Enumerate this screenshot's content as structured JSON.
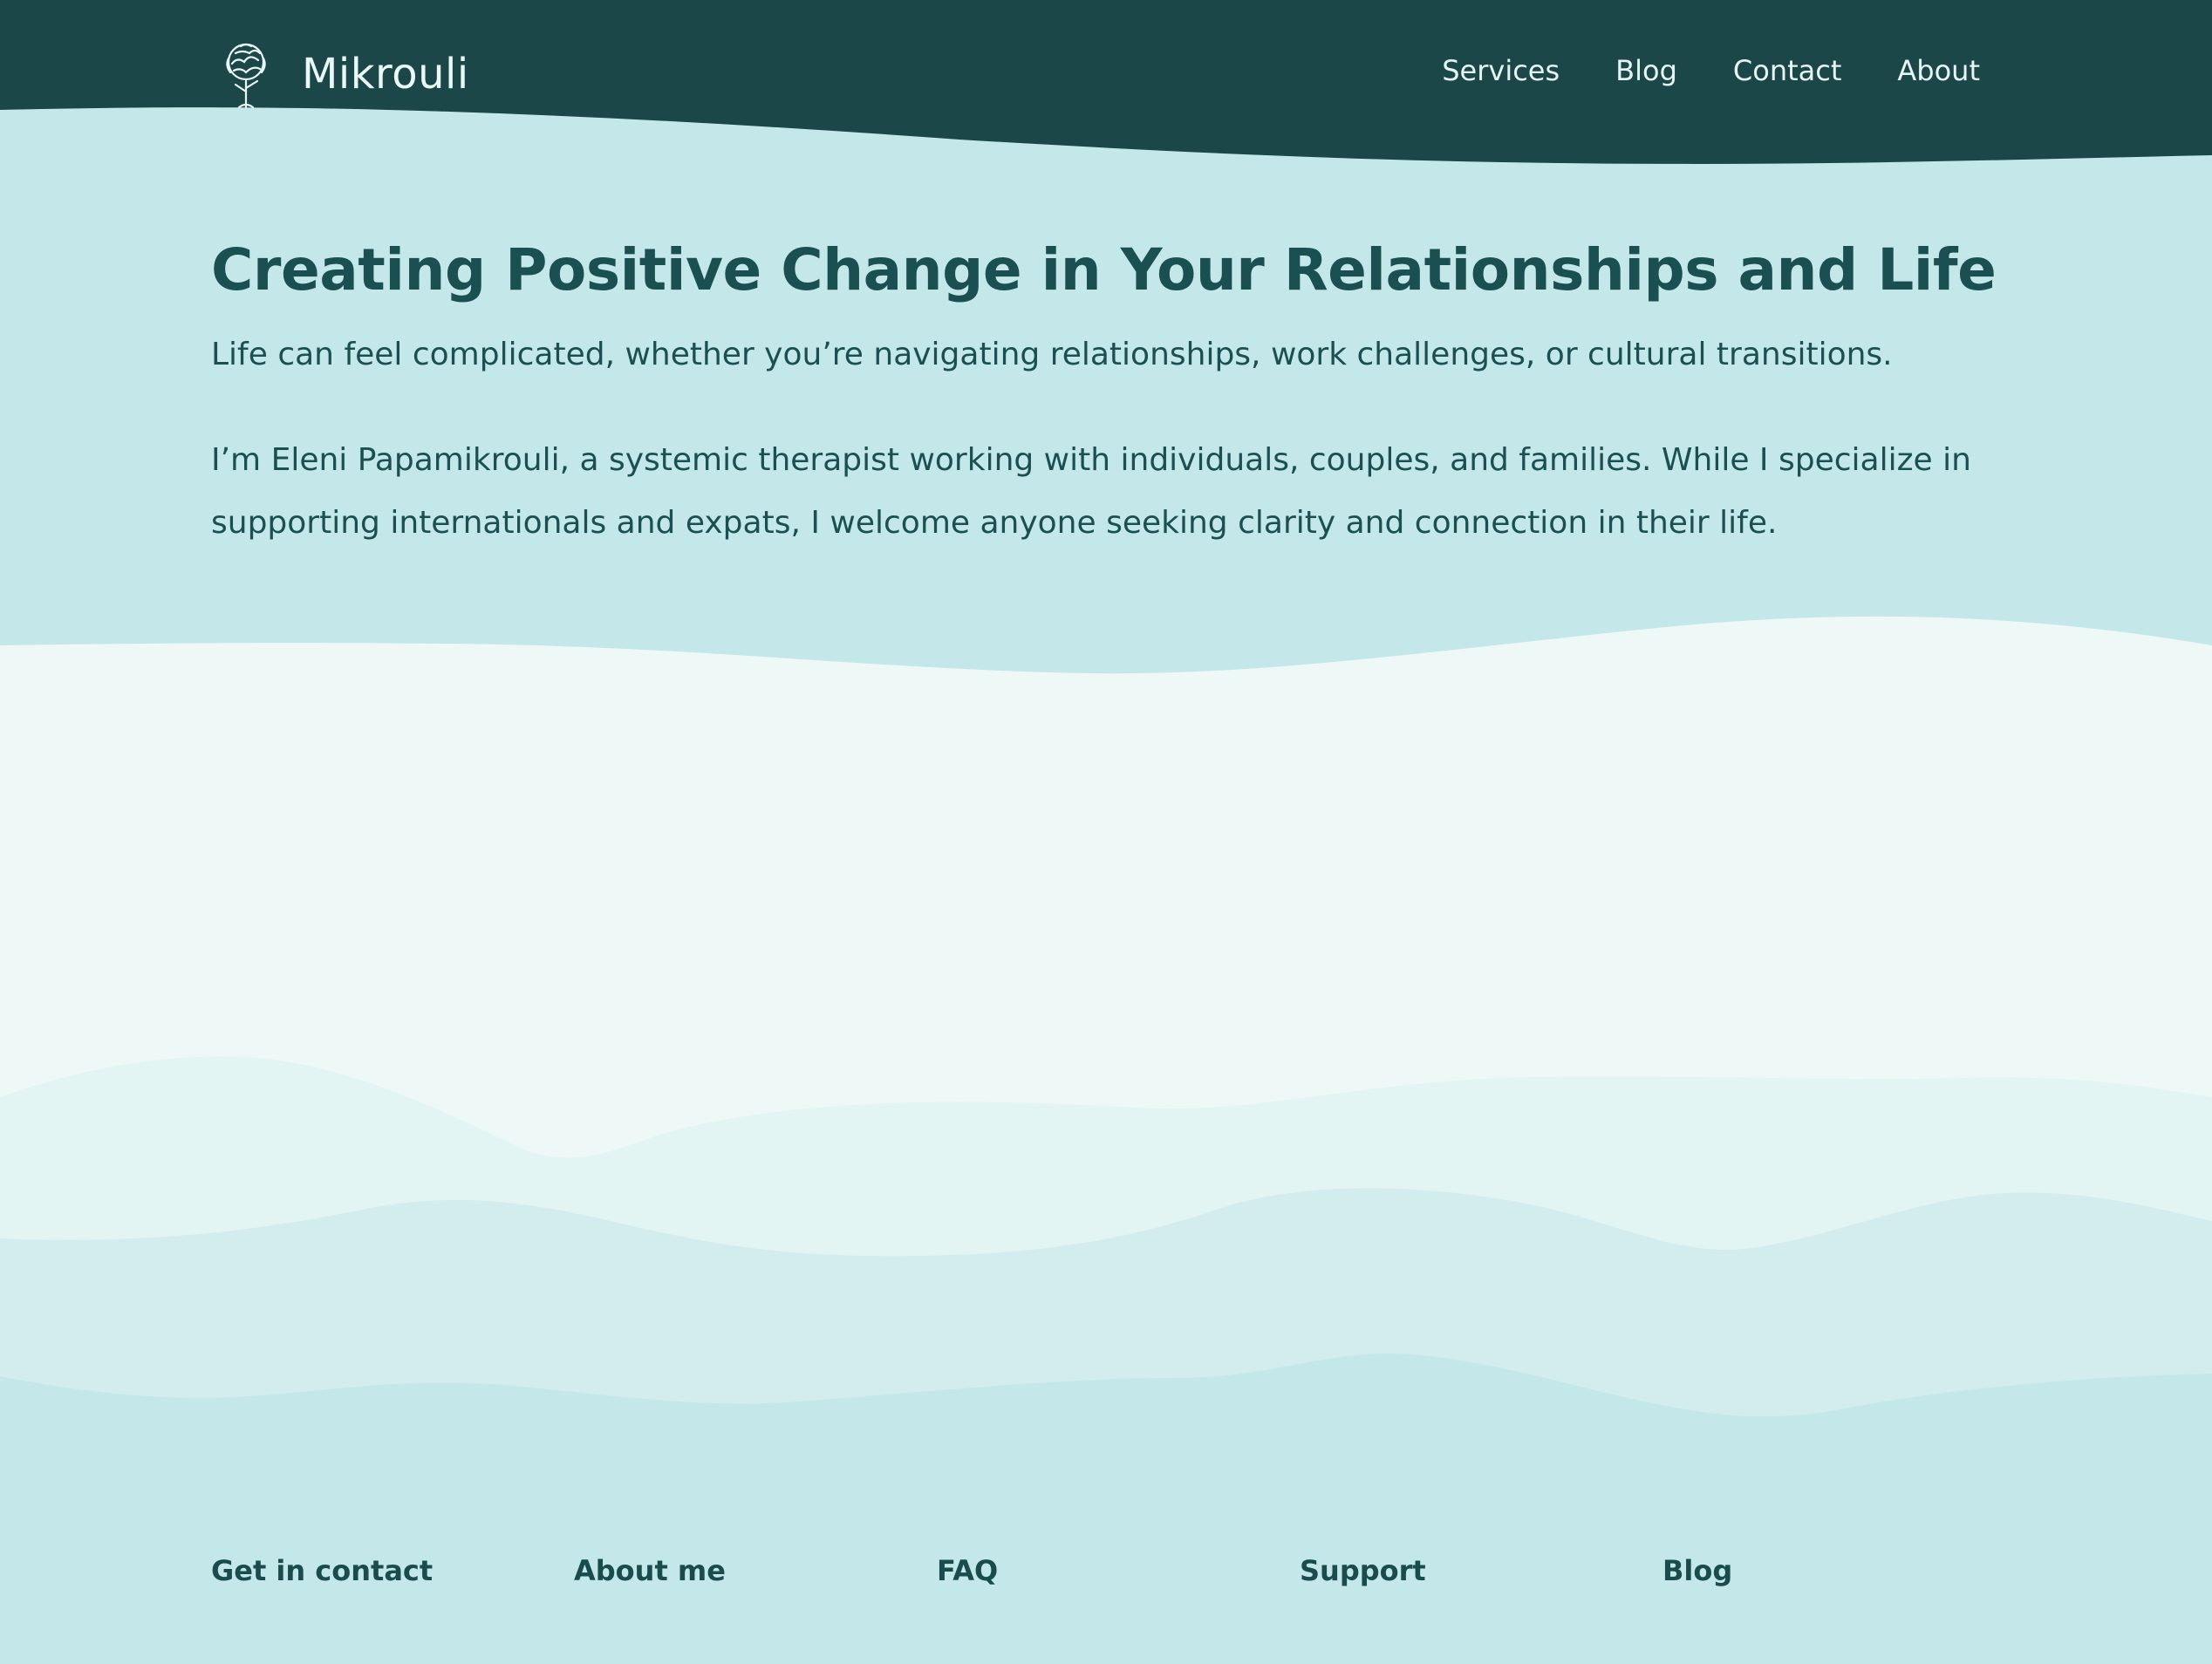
{
  "brand": {
    "name": "Mikrouli",
    "icon": "tree-icon"
  },
  "nav": {
    "items": [
      {
        "label": "Services"
      },
      {
        "label": "Blog"
      },
      {
        "label": "Contact"
      },
      {
        "label": "About"
      }
    ]
  },
  "hero": {
    "title": "Creating Positive Change in Your Relationships and Life",
    "lead": "Life can feel complicated, whether you’re navigating relationships, work challenges, or cultural transitions.",
    "bio": "I’m Eleni Papamikrouli, a systemic therapist working with individuals, couples, and families. While I specialize in supporting internationals and expats, I welcome anyone seeking clarity and connection in their life."
  },
  "footer": {
    "links": [
      {
        "label": "Get in contact"
      },
      {
        "label": "About me"
      },
      {
        "label": "FAQ"
      },
      {
        "label": "Support"
      },
      {
        "label": "Blog"
      }
    ]
  },
  "colors": {
    "header": "#1b4749",
    "hero_band": "#c4e8e9",
    "light_band": "#eef8f7",
    "text": "#1b5052"
  }
}
